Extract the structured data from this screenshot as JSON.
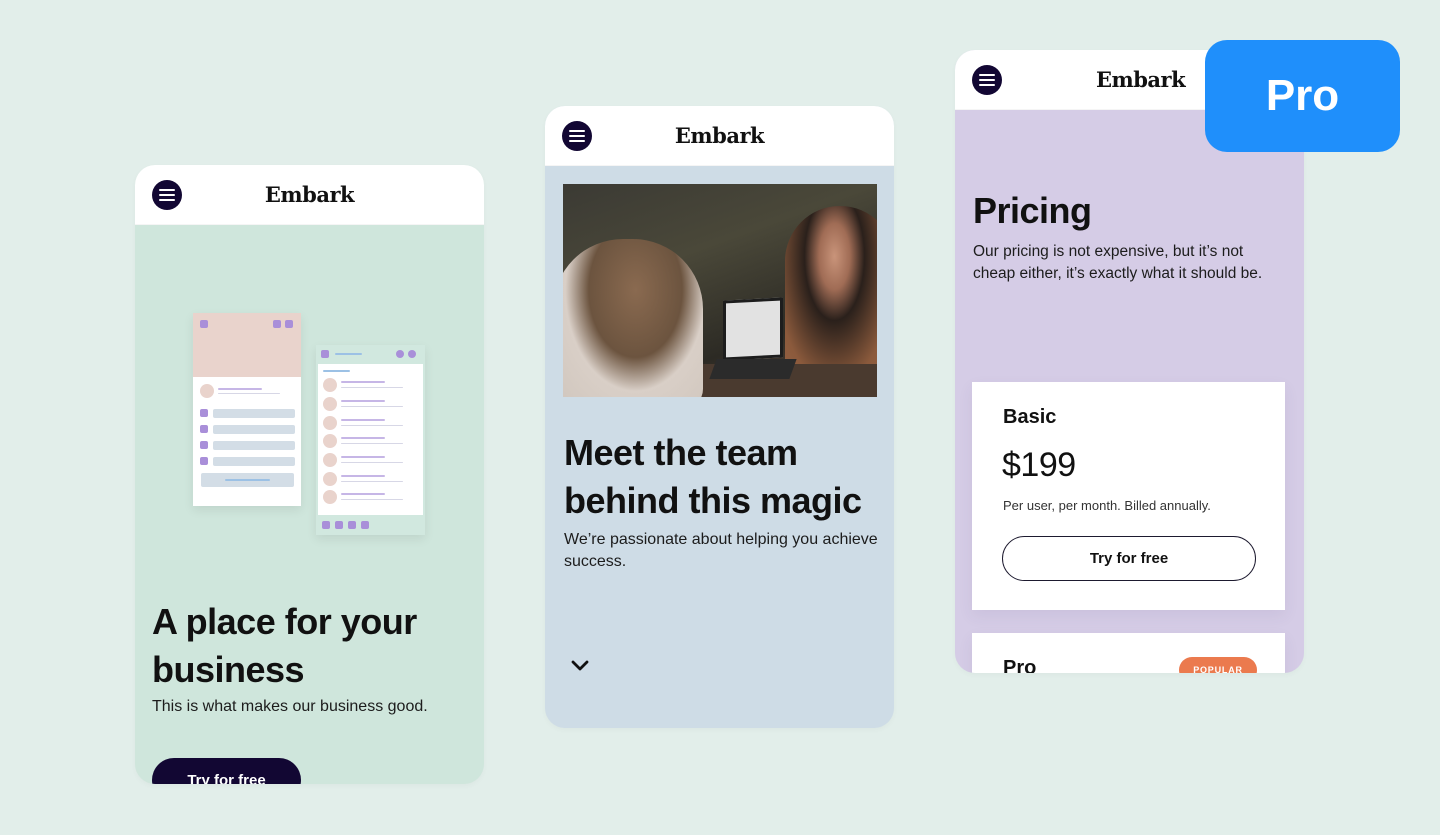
{
  "brand": {
    "name": "Embark",
    "menu_icon": "hamburger-menu-icon"
  },
  "colors": {
    "background": "#e2eeea",
    "phone1_bg": "#cfe6dc",
    "phone2_bg": "#cedce6",
    "phone3_bg": "#d5cce6",
    "dark_button": "#120733",
    "pro_tag": "#1f8ffb",
    "popular_badge": "#eb7a4e"
  },
  "pro_tag": {
    "label": "Pro"
  },
  "phone1": {
    "headline": "A place for your business",
    "subtext": "This is what makes our business good.",
    "cta_label": "Try for free",
    "illustration": "app-mockup-illustration"
  },
  "phone2": {
    "image": "team-meeting-photo",
    "headline": "Meet the team behind this magic",
    "subtext": "We’re passionate about helping you achieve success.",
    "scroll_icon": "chevron-down-icon"
  },
  "phone3": {
    "headline": "Pricing",
    "subtext": "Our pricing is not expensive, but it’s not cheap either, it’s exactly what it should be.",
    "plans": [
      {
        "name": "Basic",
        "price": "$199",
        "note": "Per user, per month. Billed annually.",
        "cta_label": "Try for free"
      },
      {
        "name": "Pro",
        "badge": "POPULAR"
      }
    ]
  }
}
